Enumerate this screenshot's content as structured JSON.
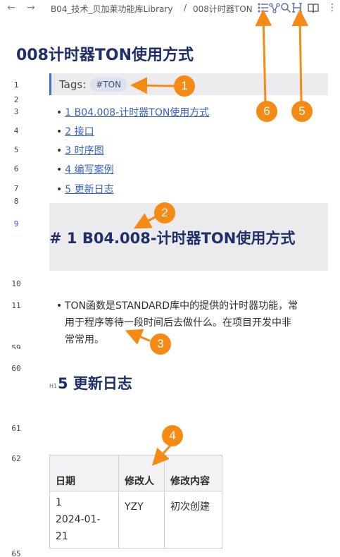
{
  "topbar": {
    "back_icon": "arrow-left-icon",
    "forward_icon": "arrow-right-icon",
    "breadcrumb": "B04_技术_贝加莱功能库Library",
    "separator": "/",
    "current": "008计时器TON",
    "icons": [
      "list-outline-icon",
      "graph-icon",
      "search-icon",
      "heading-icon",
      "book-icon",
      "more-icon"
    ]
  },
  "page": {
    "title": "008计时器TON使用方式"
  },
  "line_numbers": {
    "l1": "1",
    "l2": "2",
    "l3": "3",
    "l4": "4",
    "l5": "5",
    "l6": "6",
    "l7": "7",
    "l8": "8",
    "l9": "9",
    "l10": "10",
    "l11": "11",
    "l59": "59",
    "l60": "60",
    "l61": "61",
    "l62": "62",
    "l65": "65"
  },
  "tags": {
    "label": "Tags:",
    "value": "#TON"
  },
  "toc": [
    {
      "bullet": "•",
      "label": "1 B04.008-计时器TON使用方式"
    },
    {
      "bullet": "•",
      "label": "2 接口"
    },
    {
      "bullet": "•",
      "label": "3 时序图"
    },
    {
      "bullet": "•",
      "label": "4 编写案例"
    },
    {
      "bullet": "•",
      "label": "5 更新日志"
    }
  ],
  "section1": {
    "heading": "# 1 B04.008-计时器TON使用方式"
  },
  "paragraph": {
    "bullet": "•",
    "line1": "TON函数是STANDARD库中的提供的计时器功能，常",
    "line2": "用于程序等待一段时间后去做什么。在项目开发中非",
    "line3": "常常用。"
  },
  "section5": {
    "level": "H1",
    "heading": "5 更新日志"
  },
  "table": {
    "headers": [
      "日期",
      "修改人",
      "修改内容"
    ],
    "rows": [
      [
        "1",
        "2024-01-21",
        "YZY",
        "初次创建"
      ]
    ]
  },
  "annotations": [
    "1",
    "2",
    "3",
    "4",
    "5",
    "6"
  ],
  "colors": {
    "accent": "#f58b14",
    "heading": "#1e2f6a",
    "link": "#3a62c4"
  }
}
